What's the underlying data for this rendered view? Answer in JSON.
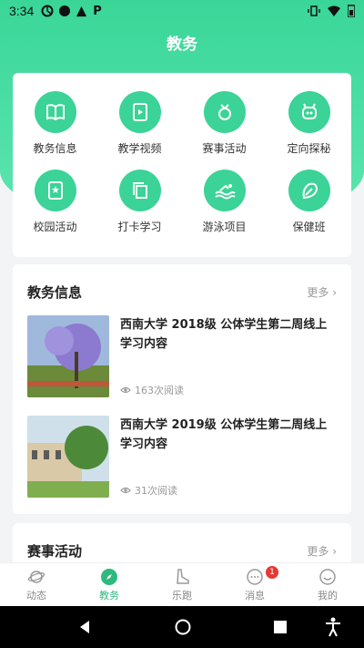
{
  "status": {
    "time": "3:34"
  },
  "header": {
    "title": "教务"
  },
  "menu": [
    {
      "label": "教务信息",
      "icon": "book-icon"
    },
    {
      "label": "教学视频",
      "icon": "video-icon"
    },
    {
      "label": "赛事活动",
      "icon": "medal-icon"
    },
    {
      "label": "定向探秘",
      "icon": "compass-icon"
    },
    {
      "label": "校园活动",
      "icon": "star-badge-icon"
    },
    {
      "label": "打卡学习",
      "icon": "copy-icon"
    },
    {
      "label": "游泳项目",
      "icon": "swim-icon"
    },
    {
      "label": "保健班",
      "icon": "leaf-icon"
    }
  ],
  "news": {
    "title": "教务信息",
    "more": "更多",
    "items": [
      {
        "title": "西南大学 2018级 公体学生第二周线上学习内容",
        "reads": "163次阅读"
      },
      {
        "title": "西南大学 2019级 公体学生第二周线上学习内容",
        "reads": "31次阅读"
      }
    ]
  },
  "events": {
    "title": "赛事活动",
    "more": "更多"
  },
  "tabs": [
    {
      "label": "动态"
    },
    {
      "label": "教务"
    },
    {
      "label": "乐跑"
    },
    {
      "label": "消息",
      "badge": "1"
    },
    {
      "label": "我的"
    }
  ],
  "colors": {
    "accent": "#3bd397",
    "active_tab": "#2fb97f",
    "badge": "#e53935"
  }
}
